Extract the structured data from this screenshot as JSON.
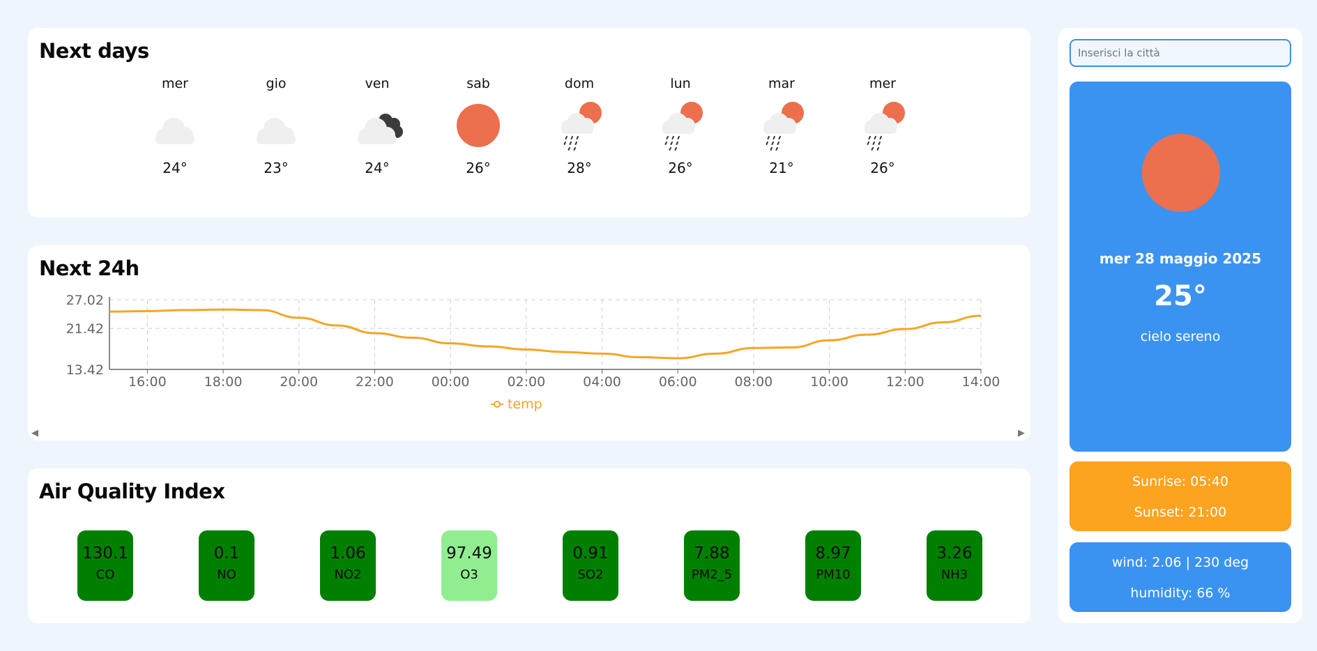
{
  "next_days": {
    "title": "Next days",
    "days": [
      {
        "name": "mer",
        "icon": "cloud-icon",
        "temp": "24°"
      },
      {
        "name": "gio",
        "icon": "cloud-icon",
        "temp": "23°"
      },
      {
        "name": "ven",
        "icon": "broken-clouds-icon",
        "temp": "24°"
      },
      {
        "name": "sab",
        "icon": "sun-icon",
        "temp": "26°"
      },
      {
        "name": "dom",
        "icon": "sun-rain-icon",
        "temp": "28°"
      },
      {
        "name": "lun",
        "icon": "sun-rain-icon",
        "temp": "26°"
      },
      {
        "name": "mar",
        "icon": "sun-rain-icon",
        "temp": "21°"
      },
      {
        "name": "mer",
        "icon": "sun-rain-icon",
        "temp": "26°"
      }
    ]
  },
  "next_24h": {
    "title": "Next 24h",
    "scroll_left": "◀",
    "scroll_right": "▶"
  },
  "chart_data": {
    "type": "line",
    "x": [
      "15:00",
      "16:00",
      "17:00",
      "18:00",
      "19:00",
      "20:00",
      "21:00",
      "22:00",
      "23:00",
      "00:00",
      "01:00",
      "02:00",
      "03:00",
      "04:00",
      "05:00",
      "06:00",
      "07:00",
      "08:00",
      "09:00",
      "10:00",
      "11:00",
      "12:00",
      "13:00",
      "14:00"
    ],
    "x_ticks": [
      "16:00",
      "18:00",
      "20:00",
      "22:00",
      "00:00",
      "02:00",
      "04:00",
      "06:00",
      "08:00",
      "10:00",
      "12:00",
      "14:00"
    ],
    "y_ticks": [
      "27.02",
      "21.42",
      "13.42"
    ],
    "series": [
      {
        "name": "temp",
        "color": "#f5a524",
        "values": [
          24.7,
          24.8,
          25.0,
          25.1,
          25.0,
          23.5,
          22.0,
          20.5,
          19.6,
          18.5,
          17.9,
          17.3,
          16.8,
          16.5,
          15.8,
          15.6,
          16.5,
          17.6,
          17.7,
          19.1,
          20.2,
          21.3,
          22.6,
          23.9
        ]
      }
    ],
    "ylim": [
      13.42,
      27.02
    ],
    "grid": true,
    "legend": "bottom"
  },
  "aqi": {
    "title": "Air Quality Index",
    "items": [
      {
        "value": "130.1",
        "label": "CO",
        "color": "#007f00"
      },
      {
        "value": "0.1",
        "label": "NO",
        "color": "#007f00"
      },
      {
        "value": "1.06",
        "label": "NO2",
        "color": "#007f00"
      },
      {
        "value": "97.49",
        "label": "O3",
        "color": "#90ee90"
      },
      {
        "value": "0.91",
        "label": "SO2",
        "color": "#007f00"
      },
      {
        "value": "7.88",
        "label": "PM2_5",
        "color": "#007f00"
      },
      {
        "value": "8.97",
        "label": "PM10",
        "color": "#007f00"
      },
      {
        "value": "3.26",
        "label": "NH3",
        "color": "#007f00"
      }
    ]
  },
  "sidebar": {
    "search_placeholder": "Inserisci la città",
    "current": {
      "icon": "sun-icon",
      "date": "mer 28 maggio 2025",
      "temp": "25°",
      "description": "cielo sereno"
    },
    "sunrise": "Sunrise: 05:40",
    "sunset": "Sunset: 21:00",
    "wind": "wind: 2.06 | 230 deg",
    "humidity": "humidity: 66 %"
  },
  "colors": {
    "background": "#eef6fd",
    "accent_blue": "#3b93f1",
    "accent_orange": "#fca320",
    "sun": "#ec6f4e",
    "line": "#f5a524"
  }
}
